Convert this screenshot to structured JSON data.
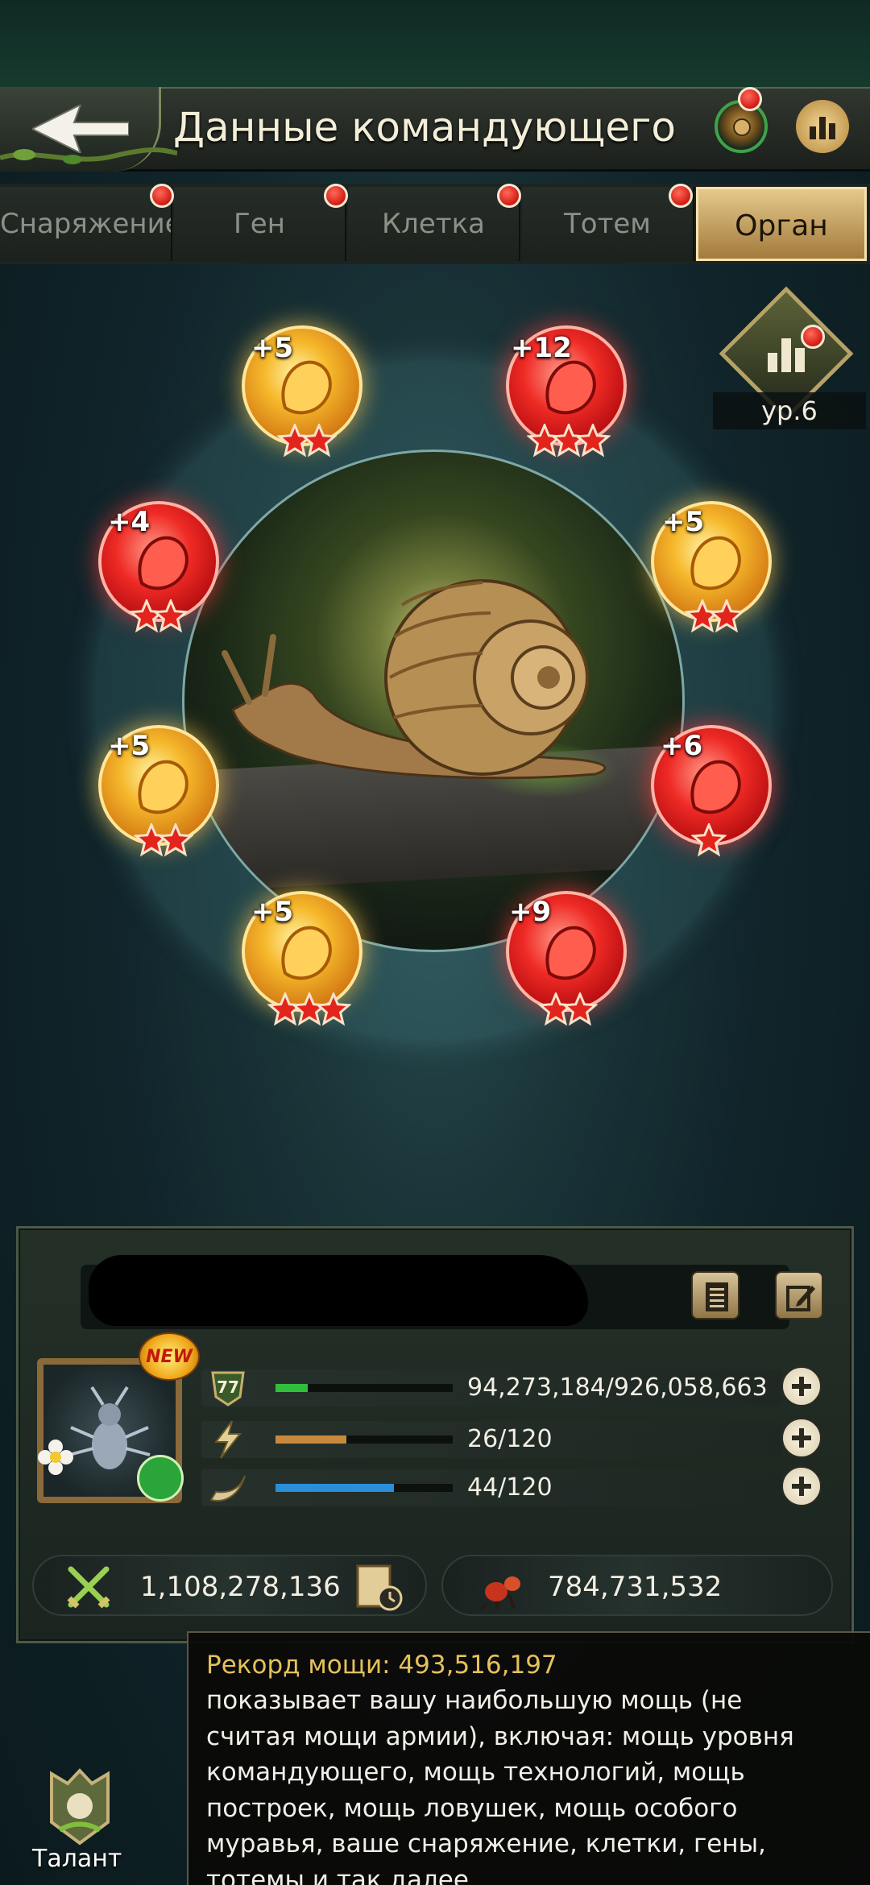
{
  "header": {
    "title": "Данные командующего"
  },
  "tabs": [
    {
      "label": "Снаряжение",
      "badge": true
    },
    {
      "label": "Ген",
      "badge": true
    },
    {
      "label": "Клетка",
      "badge": true
    },
    {
      "label": "Тотем",
      "badge": true
    },
    {
      "label": "Орган",
      "badge": false,
      "active": true
    }
  ],
  "level_badge": {
    "label": "ур.6"
  },
  "organs": [
    {
      "level": "+5",
      "color": "gold",
      "stars": 2
    },
    {
      "level": "+12",
      "color": "red",
      "stars": 3
    },
    {
      "level": "+4",
      "color": "red",
      "stars": 2
    },
    {
      "level": "+5",
      "color": "gold",
      "stars": 2
    },
    {
      "level": "+5",
      "color": "gold",
      "stars": 2
    },
    {
      "level": "+6",
      "color": "red",
      "stars": 1
    },
    {
      "level": "+5",
      "color": "gold",
      "stars": 3
    },
    {
      "level": "+9",
      "color": "red",
      "stars": 2
    }
  ],
  "commander": {
    "new_badge": "NEW",
    "level": "77",
    "stats": [
      {
        "text": "94,273,184/926,058,663",
        "fill": 0.18,
        "color": "#2fbf3b"
      },
      {
        "text": "26/120",
        "fill": 0.4,
        "color": "#c9893d"
      },
      {
        "text": "44/120",
        "fill": 0.67,
        "color": "#2a8fd8"
      }
    ],
    "power": "1,108,278,136",
    "army_power": "784,731,532"
  },
  "tooltip": {
    "title": "Рекорд мощи: 493,516,197",
    "lines": [
      "показывает вашу наибольшую мощь (не",
      "считая мощи армии), включая: мощь уровня",
      "командующего, мощь технологий, мощь",
      "построек, мощь ловушек, мощь особого",
      "муравья, ваше снаряжение, клетки, гены,",
      "тотемы и так далее."
    ]
  },
  "talent": {
    "label": "Талант"
  },
  "colors": {
    "accent_gold": "#e6c15a",
    "active_tab": "#d7b56f",
    "badge_red": "#e0241a"
  }
}
